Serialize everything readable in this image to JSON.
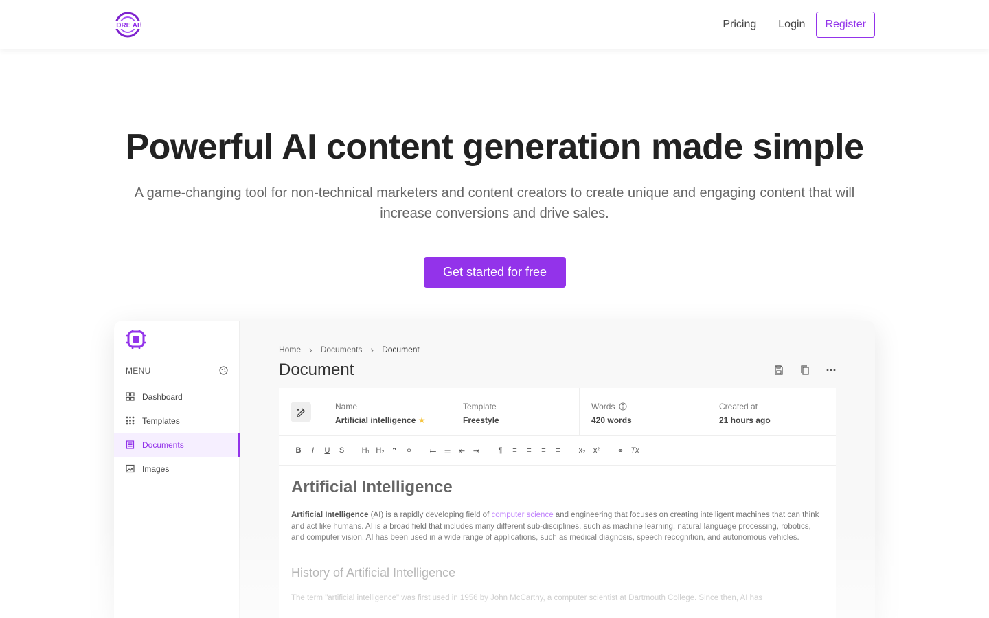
{
  "header": {
    "logo_alt": "DRE AI",
    "logo_text": "DRE AI",
    "nav": {
      "pricing": "Pricing",
      "login": "Login",
      "register": "Register"
    }
  },
  "hero": {
    "title": "Powerful AI content generation made simple",
    "subtitle": "A game-changing tool for non-technical marketers and content creators to create unique and engaging content that will increase conversions and drive sales.",
    "cta": "Get started for free"
  },
  "preview": {
    "sidebar": {
      "menu_label": "MENU",
      "items": [
        {
          "label": "Dashboard",
          "icon": "dashboard-icon"
        },
        {
          "label": "Templates",
          "icon": "grid-dots-icon"
        },
        {
          "label": "Documents",
          "icon": "document-icon",
          "active": true
        },
        {
          "label": "Images",
          "icon": "image-icon"
        }
      ]
    },
    "breadcrumb": [
      "Home",
      "Documents",
      "Document"
    ],
    "title": "Document",
    "meta": {
      "name_label": "Name",
      "name_value": "Artificial intelligence",
      "template_label": "Template",
      "template_value": "Freestyle",
      "words_label": "Words",
      "words_value": "420 words",
      "created_label": "Created at",
      "created_value": "21 hours ago"
    },
    "editor": {
      "h1": "Artificial Intelligence",
      "p1_bold": "Artificial Intelligence",
      "p1_a": " (AI) is a rapidly developing field of ",
      "p1_link": "computer science",
      "p1_b": " and engineering that focuses on creating intelligent machines that can think and act like humans. AI is a broad field that includes many different sub-disciplines, such as machine learning, natural language processing, robotics, and computer vision. AI has been used in a wide range of applications, such as medical diagnosis, speech recognition, and autonomous vehicles.",
      "h2": "History of Artificial Intelligence",
      "p2": "The term \"artificial intelligence\" was first used in 1956 by John McCarthy, a computer scientist at Dartmouth College. Since then, AI has"
    }
  },
  "colors": {
    "accent": "#9333ea",
    "accent_light": "#f6efff",
    "text_dark": "#222222",
    "text_muted": "#666666"
  }
}
